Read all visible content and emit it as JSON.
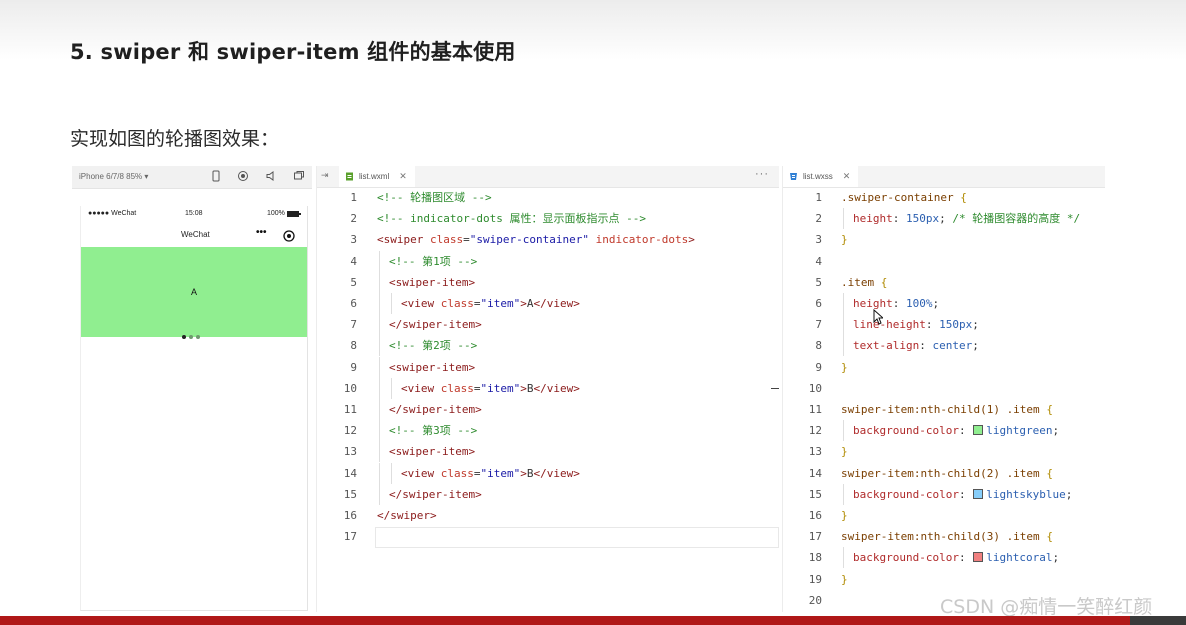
{
  "slide": {
    "title": "5. swiper 和 swiper-item 组件的基本使用",
    "subtitle": "实现如图的轮播图效果："
  },
  "simulator": {
    "device": "iPhone 6/7/8 85% ▾",
    "status": {
      "carrier": "●●●●● WeChat",
      "time": "15:08",
      "battery": "100%"
    },
    "nav_title": "WeChat",
    "capsule_more": "•••",
    "swiper": {
      "item_text": "A",
      "color": "#90ee90",
      "dots": 3,
      "active_dot": 0
    }
  },
  "xml_editor": {
    "tab": "list.wxml",
    "lines": [
      [
        {
          "c": "comment",
          "t": "<!-- 轮播图区域 -->"
        }
      ],
      [
        {
          "c": "comment",
          "t": "<!-- indicator-dots 属性：显示面板指示点 -->"
        }
      ],
      [
        {
          "c": "tag",
          "t": "<swiper "
        },
        {
          "c": "attr",
          "t": "class"
        },
        {
          "c": "punct",
          "t": "="
        },
        {
          "c": "str",
          "t": "\"swiper-container\""
        },
        {
          "c": "attr",
          "t": " indicator-dots"
        },
        {
          "c": "tag",
          "t": ">"
        }
      ],
      [
        {
          "c": "comment",
          "t": "<!-- 第1项 -->"
        }
      ],
      [
        {
          "c": "tag",
          "t": "<swiper-item>"
        }
      ],
      [
        {
          "c": "tag",
          "t": "<view "
        },
        {
          "c": "attr",
          "t": "class"
        },
        {
          "c": "punct",
          "t": "="
        },
        {
          "c": "str",
          "t": "\"item\""
        },
        {
          "c": "tag",
          "t": ">"
        },
        {
          "c": "punct",
          "t": "A"
        },
        {
          "c": "tag",
          "t": "</view>"
        }
      ],
      [
        {
          "c": "tag",
          "t": "</swiper-item>"
        }
      ],
      [
        {
          "c": "comment",
          "t": "<!-- 第2项 -->"
        }
      ],
      [
        {
          "c": "tag",
          "t": "<swiper-item>"
        }
      ],
      [
        {
          "c": "tag",
          "t": "<view "
        },
        {
          "c": "attr",
          "t": "class"
        },
        {
          "c": "punct",
          "t": "="
        },
        {
          "c": "str",
          "t": "\"item\""
        },
        {
          "c": "tag",
          "t": ">"
        },
        {
          "c": "punct",
          "t": "B"
        },
        {
          "c": "tag",
          "t": "</view>"
        }
      ],
      [
        {
          "c": "tag",
          "t": "</swiper-item>"
        }
      ],
      [
        {
          "c": "comment",
          "t": "<!-- 第3项 -->"
        }
      ],
      [
        {
          "c": "tag",
          "t": "<swiper-item>"
        }
      ],
      [
        {
          "c": "tag",
          "t": "<view "
        },
        {
          "c": "attr",
          "t": "class"
        },
        {
          "c": "punct",
          "t": "="
        },
        {
          "c": "str",
          "t": "\"item\""
        },
        {
          "c": "tag",
          "t": ">"
        },
        {
          "c": "punct",
          "t": "B"
        },
        {
          "c": "tag",
          "t": "</view>"
        }
      ],
      [
        {
          "c": "tag",
          "t": "</swiper-item>"
        }
      ],
      [
        {
          "c": "tag",
          "t": "</swiper>"
        }
      ],
      []
    ],
    "indent": [
      0,
      0,
      0,
      1,
      1,
      2,
      1,
      1,
      1,
      2,
      1,
      1,
      1,
      2,
      1,
      0,
      0
    ]
  },
  "wxss_editor": {
    "tab": "list.wxss",
    "lines": [
      [
        {
          "c": "sel",
          "t": ".swiper-container "
        },
        {
          "c": "brace",
          "t": "{"
        }
      ],
      [
        {
          "c": "prop",
          "t": "height"
        },
        {
          "c": "punct",
          "t": ": "
        },
        {
          "c": "val",
          "t": "150px"
        },
        {
          "c": "punct",
          "t": "; "
        },
        {
          "c": "comment",
          "t": "/* 轮播图容器的高度 */"
        }
      ],
      [
        {
          "c": "brace",
          "t": "}"
        }
      ],
      [],
      [
        {
          "c": "sel",
          "t": ".item "
        },
        {
          "c": "brace",
          "t": "{"
        }
      ],
      [
        {
          "c": "prop",
          "t": "height"
        },
        {
          "c": "punct",
          "t": ": "
        },
        {
          "c": "val",
          "t": "100%"
        },
        {
          "c": "punct",
          "t": ";"
        }
      ],
      [
        {
          "c": "prop",
          "t": "line-height"
        },
        {
          "c": "punct",
          "t": ": "
        },
        {
          "c": "val",
          "t": "150px"
        },
        {
          "c": "punct",
          "t": ";"
        }
      ],
      [
        {
          "c": "prop",
          "t": "text-align"
        },
        {
          "c": "punct",
          "t": ": "
        },
        {
          "c": "val",
          "t": "center"
        },
        {
          "c": "punct",
          "t": ";"
        }
      ],
      [
        {
          "c": "brace",
          "t": "}"
        }
      ],
      [],
      [
        {
          "c": "sel",
          "t": "swiper-item:nth-child(1) .item "
        },
        {
          "c": "brace",
          "t": "{"
        }
      ],
      [
        {
          "c": "prop",
          "t": "background-color"
        },
        {
          "c": "punct",
          "t": ": "
        },
        {
          "c": "swatch",
          "t": "",
          "color": "#90ee90"
        },
        {
          "c": "val",
          "t": "lightgreen"
        },
        {
          "c": "punct",
          "t": ";"
        }
      ],
      [
        {
          "c": "brace",
          "t": "}"
        }
      ],
      [
        {
          "c": "sel",
          "t": "swiper-item:nth-child(2) .item "
        },
        {
          "c": "brace",
          "t": "{"
        }
      ],
      [
        {
          "c": "prop",
          "t": "background-color"
        },
        {
          "c": "punct",
          "t": ": "
        },
        {
          "c": "swatch",
          "t": "",
          "color": "#87cefa"
        },
        {
          "c": "val",
          "t": "lightskyblue"
        },
        {
          "c": "punct",
          "t": ";"
        }
      ],
      [
        {
          "c": "brace",
          "t": "}"
        }
      ],
      [
        {
          "c": "sel",
          "t": "swiper-item:nth-child(3) .item "
        },
        {
          "c": "brace",
          "t": "{"
        }
      ],
      [
        {
          "c": "prop",
          "t": "background-color"
        },
        {
          "c": "punct",
          "t": ": "
        },
        {
          "c": "swatch",
          "t": "",
          "color": "#f08080"
        },
        {
          "c": "val",
          "t": "lightcoral"
        },
        {
          "c": "punct",
          "t": ";"
        }
      ],
      [
        {
          "c": "brace",
          "t": "}"
        }
      ],
      []
    ],
    "indent": [
      0,
      1,
      0,
      0,
      0,
      1,
      1,
      1,
      0,
      0,
      0,
      1,
      0,
      0,
      1,
      0,
      0,
      1,
      0,
      0
    ]
  },
  "watermark": "CSDN @痴情一笑醉红颜",
  "colors": {
    "bottom_bar": "#b01818",
    "swiper_bg": "#90ee90"
  }
}
